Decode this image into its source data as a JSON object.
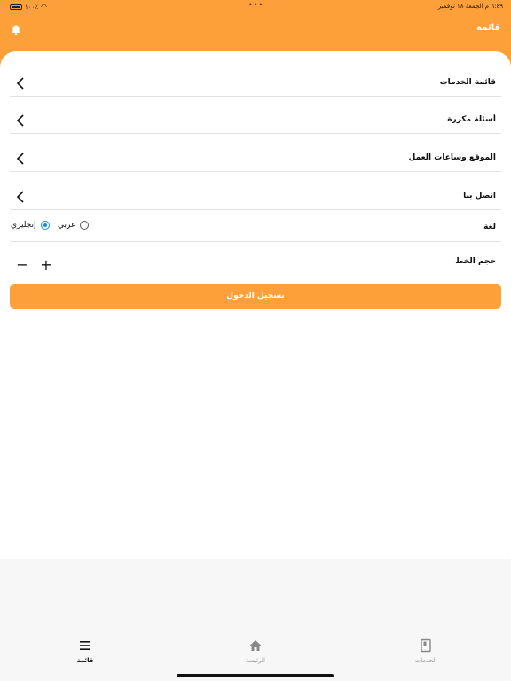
{
  "status_bar": {
    "time_date": "٦:٤٩ م   الجمعة ١٨ نوفمبر",
    "battery": "١٠٠٪",
    "dots": "•••"
  },
  "header": {
    "title": "قائمة",
    "notification_icon": "bell-icon"
  },
  "menu": {
    "items": [
      {
        "label": "قائمة الخدمات",
        "icon": "chevron-left-icon"
      },
      {
        "label": "أسئلة مكررة",
        "icon": "chevron-left-icon"
      },
      {
        "label": "الموقع وساعات العمل",
        "icon": "chevron-left-icon"
      },
      {
        "label": "اتصل بنا",
        "icon": "chevron-left-icon"
      }
    ],
    "language": {
      "label": "لغة",
      "options": [
        "عربي",
        "إنجليزي"
      ],
      "selected": "إنجليزي"
    },
    "font_size": {
      "label": "حجم الخط",
      "decrease": "−",
      "increase": "+"
    },
    "login_button": "تسجيل الدخول"
  },
  "tabbar": {
    "tabs": [
      {
        "label": "قائمة",
        "icon": "menu-icon",
        "active": true
      },
      {
        "label": "الرئيسة",
        "icon": "home-icon",
        "active": false
      },
      {
        "label": "الخدمات",
        "icon": "book-icon",
        "active": false
      }
    ]
  },
  "colors": {
    "accent": "#fea03a",
    "radio_selected": "#1e88e5"
  }
}
